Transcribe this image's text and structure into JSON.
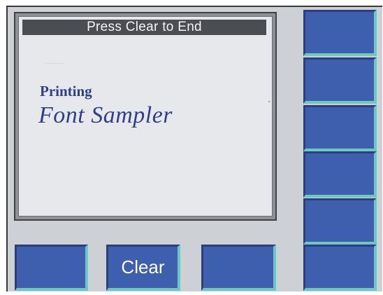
{
  "display": {
    "title_bar": "Press Clear to End",
    "line1": "Printing",
    "line2": "Font Sampler"
  },
  "bottom_keys": [
    {
      "label": ""
    },
    {
      "label": "Clear"
    },
    {
      "label": ""
    }
  ],
  "side_keys": [
    {
      "label": ""
    },
    {
      "label": ""
    },
    {
      "label": ""
    },
    {
      "label": ""
    },
    {
      "label": ""
    },
    {
      "label": ""
    }
  ],
  "colors": {
    "panel": "#cdd0d4",
    "screen": "#e6e8eb",
    "title_bar": "#4a4d51",
    "key_face": "#3e5fae",
    "key_shadow": "#2a3f7d",
    "key_highlight": "#6fc8c0",
    "text_blue": "#2f3f8f"
  }
}
